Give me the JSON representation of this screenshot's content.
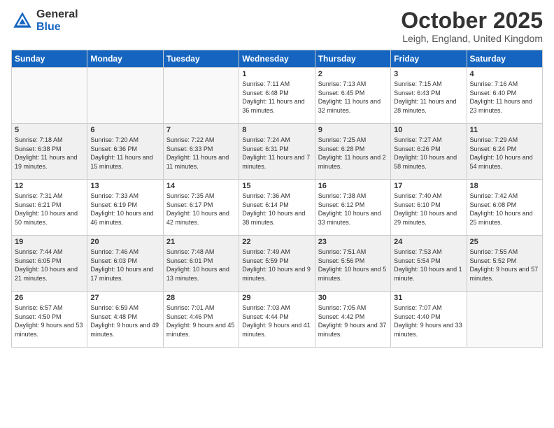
{
  "logo": {
    "general": "General",
    "blue": "Blue"
  },
  "header": {
    "month": "October 2025",
    "location": "Leigh, England, United Kingdom"
  },
  "days_of_week": [
    "Sunday",
    "Monday",
    "Tuesday",
    "Wednesday",
    "Thursday",
    "Friday",
    "Saturday"
  ],
  "weeks": [
    [
      {
        "day": "",
        "info": ""
      },
      {
        "day": "",
        "info": ""
      },
      {
        "day": "",
        "info": ""
      },
      {
        "day": "1",
        "info": "Sunrise: 7:11 AM\nSunset: 6:48 PM\nDaylight: 11 hours\nand 36 minutes."
      },
      {
        "day": "2",
        "info": "Sunrise: 7:13 AM\nSunset: 6:45 PM\nDaylight: 11 hours\nand 32 minutes."
      },
      {
        "day": "3",
        "info": "Sunrise: 7:15 AM\nSunset: 6:43 PM\nDaylight: 11 hours\nand 28 minutes."
      },
      {
        "day": "4",
        "info": "Sunrise: 7:16 AM\nSunset: 6:40 PM\nDaylight: 11 hours\nand 23 minutes."
      }
    ],
    [
      {
        "day": "5",
        "info": "Sunrise: 7:18 AM\nSunset: 6:38 PM\nDaylight: 11 hours\nand 19 minutes."
      },
      {
        "day": "6",
        "info": "Sunrise: 7:20 AM\nSunset: 6:36 PM\nDaylight: 11 hours\nand 15 minutes."
      },
      {
        "day": "7",
        "info": "Sunrise: 7:22 AM\nSunset: 6:33 PM\nDaylight: 11 hours\nand 11 minutes."
      },
      {
        "day": "8",
        "info": "Sunrise: 7:24 AM\nSunset: 6:31 PM\nDaylight: 11 hours\nand 7 minutes."
      },
      {
        "day": "9",
        "info": "Sunrise: 7:25 AM\nSunset: 6:28 PM\nDaylight: 11 hours\nand 2 minutes."
      },
      {
        "day": "10",
        "info": "Sunrise: 7:27 AM\nSunset: 6:26 PM\nDaylight: 10 hours\nand 58 minutes."
      },
      {
        "day": "11",
        "info": "Sunrise: 7:29 AM\nSunset: 6:24 PM\nDaylight: 10 hours\nand 54 minutes."
      }
    ],
    [
      {
        "day": "12",
        "info": "Sunrise: 7:31 AM\nSunset: 6:21 PM\nDaylight: 10 hours\nand 50 minutes."
      },
      {
        "day": "13",
        "info": "Sunrise: 7:33 AM\nSunset: 6:19 PM\nDaylight: 10 hours\nand 46 minutes."
      },
      {
        "day": "14",
        "info": "Sunrise: 7:35 AM\nSunset: 6:17 PM\nDaylight: 10 hours\nand 42 minutes."
      },
      {
        "day": "15",
        "info": "Sunrise: 7:36 AM\nSunset: 6:14 PM\nDaylight: 10 hours\nand 38 minutes."
      },
      {
        "day": "16",
        "info": "Sunrise: 7:38 AM\nSunset: 6:12 PM\nDaylight: 10 hours\nand 33 minutes."
      },
      {
        "day": "17",
        "info": "Sunrise: 7:40 AM\nSunset: 6:10 PM\nDaylight: 10 hours\nand 29 minutes."
      },
      {
        "day": "18",
        "info": "Sunrise: 7:42 AM\nSunset: 6:08 PM\nDaylight: 10 hours\nand 25 minutes."
      }
    ],
    [
      {
        "day": "19",
        "info": "Sunrise: 7:44 AM\nSunset: 6:05 PM\nDaylight: 10 hours\nand 21 minutes."
      },
      {
        "day": "20",
        "info": "Sunrise: 7:46 AM\nSunset: 6:03 PM\nDaylight: 10 hours\nand 17 minutes."
      },
      {
        "day": "21",
        "info": "Sunrise: 7:48 AM\nSunset: 6:01 PM\nDaylight: 10 hours\nand 13 minutes."
      },
      {
        "day": "22",
        "info": "Sunrise: 7:49 AM\nSunset: 5:59 PM\nDaylight: 10 hours\nand 9 minutes."
      },
      {
        "day": "23",
        "info": "Sunrise: 7:51 AM\nSunset: 5:56 PM\nDaylight: 10 hours\nand 5 minutes."
      },
      {
        "day": "24",
        "info": "Sunrise: 7:53 AM\nSunset: 5:54 PM\nDaylight: 10 hours\nand 1 minute."
      },
      {
        "day": "25",
        "info": "Sunrise: 7:55 AM\nSunset: 5:52 PM\nDaylight: 9 hours\nand 57 minutes."
      }
    ],
    [
      {
        "day": "26",
        "info": "Sunrise: 6:57 AM\nSunset: 4:50 PM\nDaylight: 9 hours\nand 53 minutes."
      },
      {
        "day": "27",
        "info": "Sunrise: 6:59 AM\nSunset: 4:48 PM\nDaylight: 9 hours\nand 49 minutes."
      },
      {
        "day": "28",
        "info": "Sunrise: 7:01 AM\nSunset: 4:46 PM\nDaylight: 9 hours\nand 45 minutes."
      },
      {
        "day": "29",
        "info": "Sunrise: 7:03 AM\nSunset: 4:44 PM\nDaylight: 9 hours\nand 41 minutes."
      },
      {
        "day": "30",
        "info": "Sunrise: 7:05 AM\nSunset: 4:42 PM\nDaylight: 9 hours\nand 37 minutes."
      },
      {
        "day": "31",
        "info": "Sunrise: 7:07 AM\nSunset: 4:40 PM\nDaylight: 9 hours\nand 33 minutes."
      },
      {
        "day": "",
        "info": ""
      }
    ]
  ]
}
